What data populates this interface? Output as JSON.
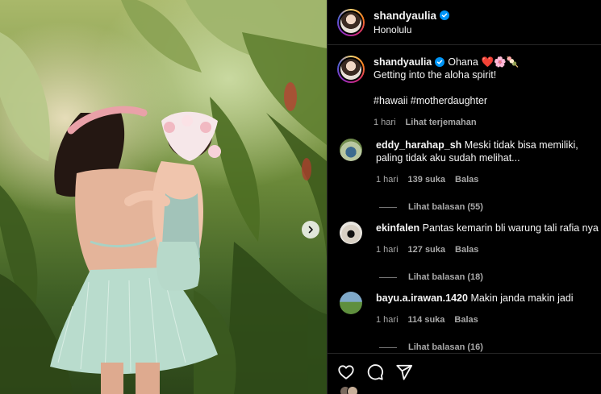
{
  "post": {
    "username": "shandyaulia",
    "location": "Honolulu",
    "caption_title": "Ohana",
    "caption_emoji": "❤️🌸🍡",
    "caption_line2": "Getting into the aloha spirit!",
    "caption_tags": "#hawaii #motherdaughter",
    "time": "1 hari",
    "translate": "Lihat terjemahan"
  },
  "comments": [
    {
      "username": "eddy_harahap_sh",
      "text": "Meski tidak bisa memiliki, paling tidak aku sudah melihat...",
      "time": "1 hari",
      "likes": "139 suka",
      "reply": "Balas",
      "view_replies": "Lihat balasan (55)"
    },
    {
      "username": "ekinfalen",
      "text": "Pantas kemarin bli warung tali rafia nya habis",
      "time": "1 hari",
      "likes": "127 suka",
      "reply": "Balas",
      "view_replies": "Lihat balasan (18)"
    },
    {
      "username": "bayu.a.irawan.1420",
      "text": "Makin janda makin jadi",
      "time": "1 hari",
      "likes": "114 suka",
      "reply": "Balas",
      "view_replies": "Lihat balasan (16)"
    }
  ],
  "icons": {
    "like": "heart-icon",
    "comment": "comment-icon",
    "share": "send-icon",
    "next": "chevron-right-icon",
    "verified": "verified-badge-icon"
  },
  "colors": {
    "background": "#000000",
    "text": "#f5f5f5",
    "secondary": "#a8a8a8",
    "verified": "#0095f6",
    "divider": "#262626"
  }
}
